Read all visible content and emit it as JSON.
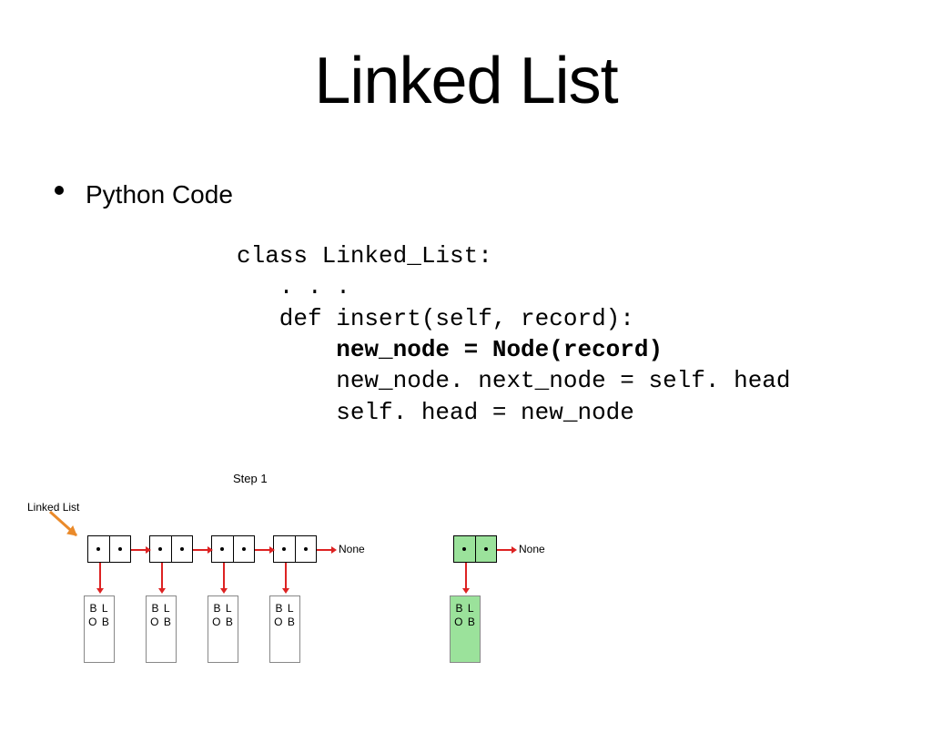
{
  "title": "Linked List",
  "bullet": "Python Code",
  "code": {
    "l1": "class Linked_List:",
    "l2": "   . . .",
    "l3": "   def insert(self, record):",
    "l4": "       new_node = Node(record)",
    "l5": "       new_node. next_node = self. head",
    "l6": "       self. head = new_node"
  },
  "diagram": {
    "step": "Step 1",
    "label": "Linked List",
    "none": "None",
    "blob": "B\nL\nO\nB"
  }
}
